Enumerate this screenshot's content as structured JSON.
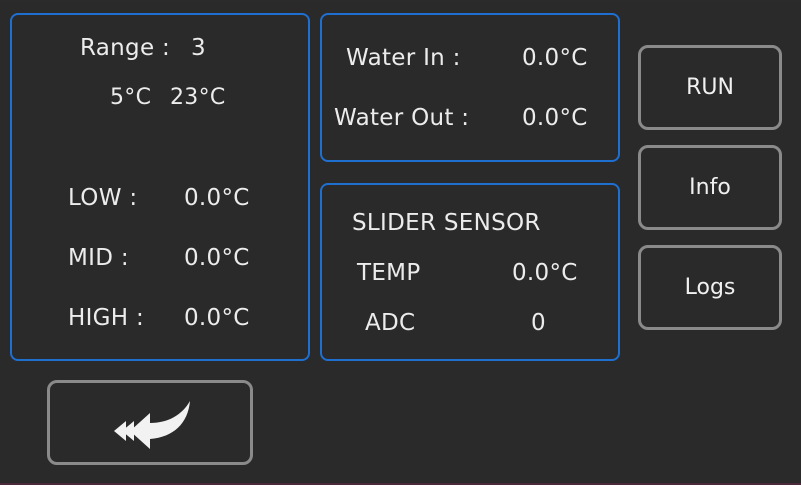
{
  "range_panel": {
    "range_label": "Range :",
    "range_value": "3",
    "min_temp": "5°C",
    "max_temp": "23°C",
    "low_label": "LOW :",
    "low_value": "0.0°C",
    "mid_label": "MID :",
    "mid_value": "0.0°C",
    "high_label": "HIGH :",
    "high_value": "0.0°C"
  },
  "water_panel": {
    "in_label": "Water In :",
    "in_value": "0.0°C",
    "out_label": "Water Out :",
    "out_value": "0.0°C"
  },
  "slider_panel": {
    "title": "SLIDER SENSOR",
    "temp_label": "TEMP",
    "temp_value": "0.0°C",
    "adc_label": "ADC",
    "adc_value": "0"
  },
  "buttons": {
    "run": "RUN",
    "info": "Info",
    "logs": "Logs"
  },
  "icons": {
    "back": "back-arrow-icon"
  },
  "colors": {
    "panel_border": "#1f6fd0",
    "button_border": "#8a8a8a",
    "background": "#2a2a2a",
    "text": "#ececec"
  }
}
